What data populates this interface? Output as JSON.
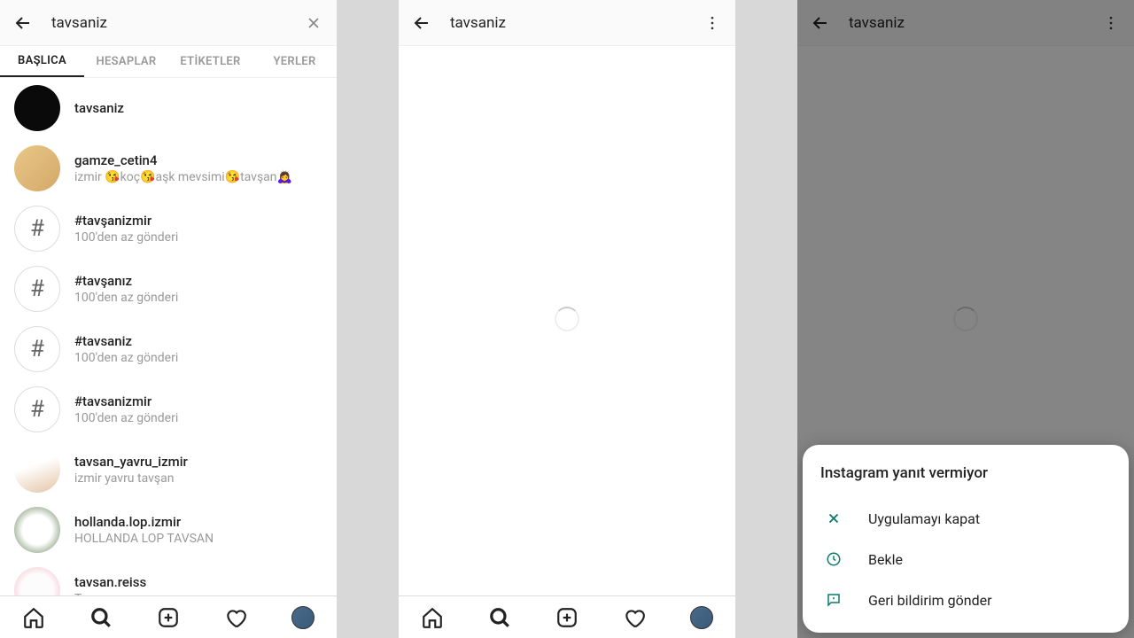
{
  "search_query": "tavsaniz",
  "tabs": [
    "BAŞLICA",
    "HESAPLAR",
    "ETİKETLER",
    "YERLER"
  ],
  "active_tab": 0,
  "results": [
    {
      "type": "user",
      "avatar": "black",
      "title": "tavsaniz",
      "sub": ""
    },
    {
      "type": "user",
      "avatar": "blonde",
      "title": "gamze_cetin4",
      "sub": "izmir 😘koç😘aşk mevsimi😘tavşan🙇‍♀️"
    },
    {
      "type": "hashtag",
      "title": "#tavşanizmir",
      "sub": "100'den az gönderi"
    },
    {
      "type": "hashtag",
      "title": "#tavşanız",
      "sub": "100'den az gönderi"
    },
    {
      "type": "hashtag",
      "title": "#tavsaniz",
      "sub": "100'den az gönderi"
    },
    {
      "type": "hashtag",
      "title": "#tavsanizmir",
      "sub": "100'den az gönderi"
    },
    {
      "type": "user",
      "avatar": "rabbit1",
      "title": "tavsan_yavru_izmir",
      "sub": "izmir yavru tavşan"
    },
    {
      "type": "user",
      "avatar": "fluffy",
      "title": "hollanda.lop.izmir",
      "sub": "HOLLANDA LOP  TAVSAN"
    },
    {
      "type": "user",
      "avatar": "rabbit2",
      "title": "tavsan.reiss",
      "sub": "Tavşanızzzz"
    }
  ],
  "screen2": {
    "title": "tavsaniz"
  },
  "screen3": {
    "title": "tavsaniz",
    "dialog_title": "Instagram yanıt vermiyor",
    "option_close": "Uygulamayı kapat",
    "option_wait": "Bekle",
    "option_feedback": "Geri bildirim gönder"
  }
}
